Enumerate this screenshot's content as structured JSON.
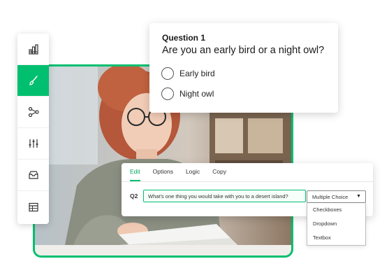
{
  "toolbar": {
    "items": [
      {
        "icon": "bar-chart-icon"
      },
      {
        "icon": "paintbrush-icon",
        "active": true
      },
      {
        "icon": "logic-branch-icon"
      },
      {
        "icon": "sliders-icon"
      },
      {
        "icon": "inbox-tray-icon"
      },
      {
        "icon": "table-grid-icon"
      }
    ],
    "accent": "#00bf6f"
  },
  "question_card": {
    "number": "Question 1",
    "text": "Are you an early bird or a night owl?",
    "options": [
      "Early bird",
      "Night owl"
    ]
  },
  "editor": {
    "tabs": [
      "Edit",
      "Options",
      "Logic",
      "Copy"
    ],
    "active_tab": "Edit",
    "question_label": "Q2",
    "question_value": "What's one thing you would take with you to a desert island?",
    "type_select": {
      "selected": "Multiple Choice",
      "options": [
        "Checkboxes",
        "Dropdown",
        "Textbox"
      ]
    }
  }
}
